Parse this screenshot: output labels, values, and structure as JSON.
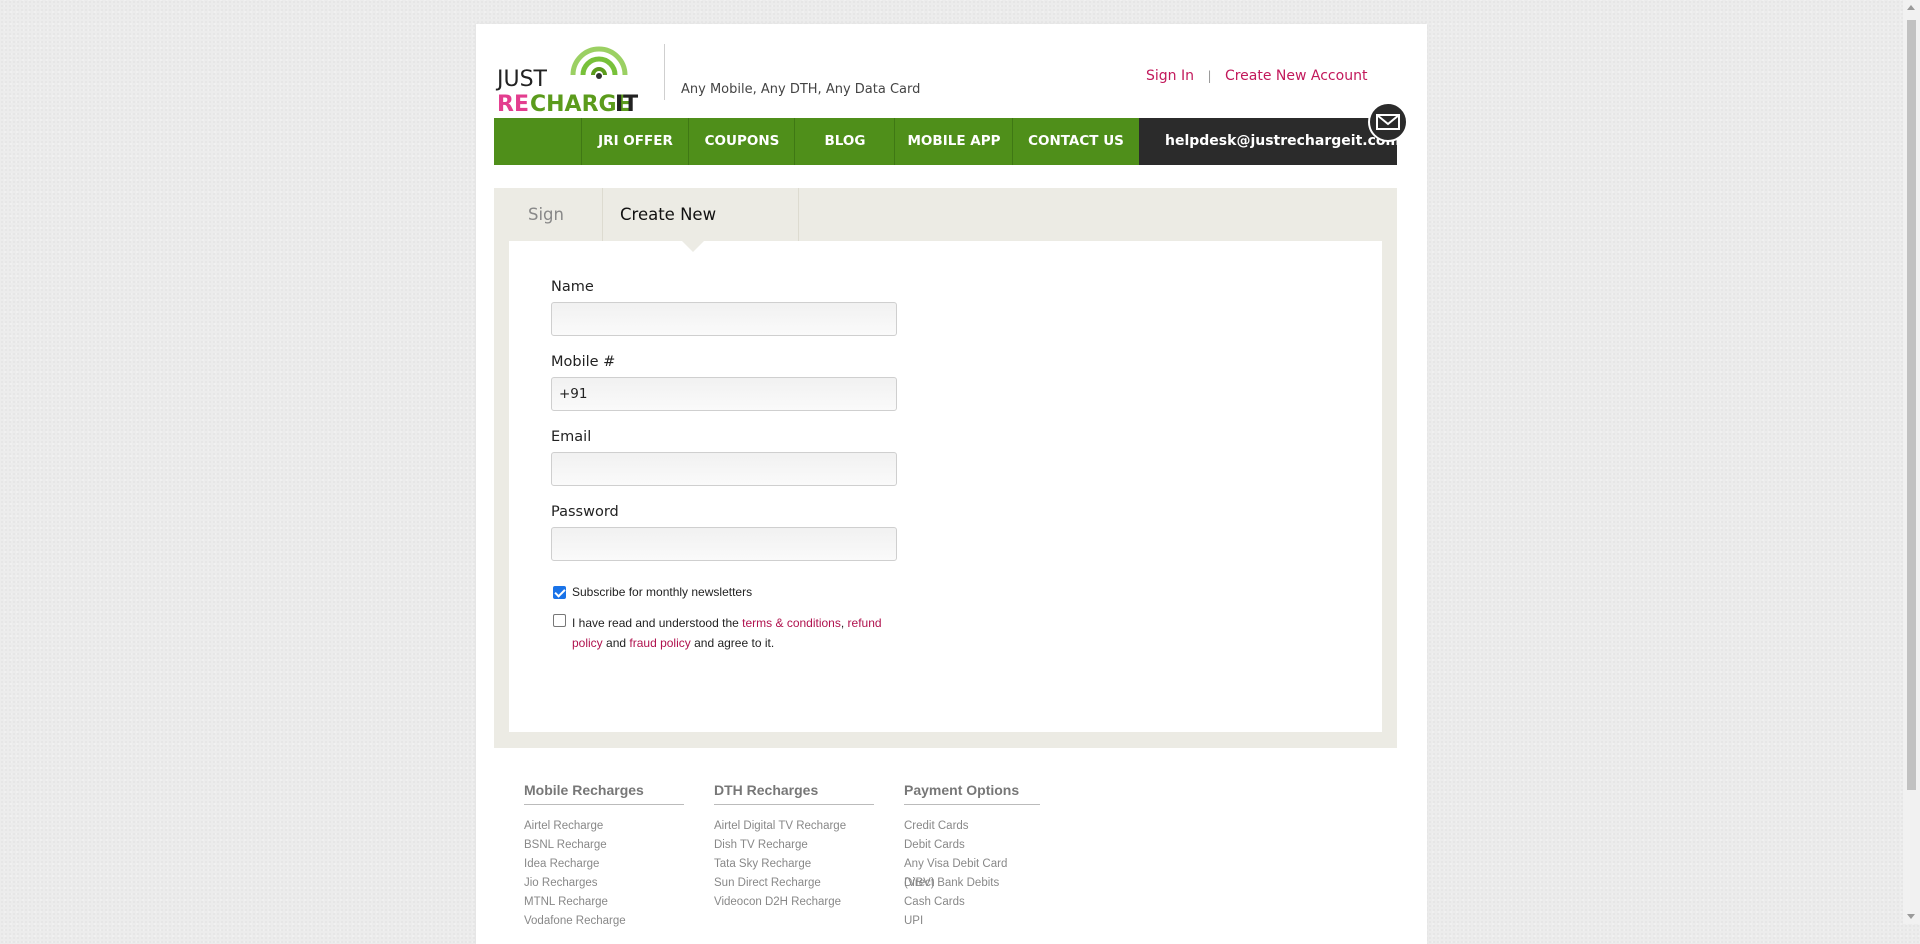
{
  "header": {
    "logo": {
      "just": "JUST",
      "re": "RE",
      "charge": "CHARGE",
      "it": "IT"
    },
    "tagline": "Any Mobile, Any DTH, Any Data Card",
    "signin_link": "Sign In",
    "separator": "|",
    "create_link": "Create New Account"
  },
  "nav": {
    "items": [
      {
        "label": "JRI OFFER"
      },
      {
        "label": "COUPONS"
      },
      {
        "label": "BLOG"
      },
      {
        "label": "MOBILE APP"
      },
      {
        "label": "CONTACT US"
      }
    ],
    "helpdesk": "helpdesk@justrechargeit.com",
    "mail_icon": "envelope-icon",
    "color": "#4f8f1a",
    "helpdesk_bg": "#2b2b2b"
  },
  "tabs": {
    "signin": "Sign In",
    "create": "Create New Account"
  },
  "form": {
    "name_label": "Name",
    "name_value": "",
    "mobile_label": "Mobile #",
    "mobile_value": "+91",
    "email_label": "Email",
    "email_value": "",
    "password_label": "Password",
    "password_value": "",
    "subscribe_label": "Subscribe for monthly newsletters",
    "subscribe_checked": true,
    "terms_prefix": "I have read and understood the ",
    "terms_link": "terms & conditions",
    "comma": ", ",
    "refund_line1": "refund",
    "refund_line2": "policy",
    "and_text": " and ",
    "fraud_link": "fraud policy",
    "agree_text": " and agree to it.",
    "terms_checked": false
  },
  "footer": {
    "mobile": {
      "heading": "Mobile Recharges",
      "links": [
        "Airtel Recharge",
        "BSNL Recharge",
        "Idea Recharge",
        "Jio Recharges",
        "MTNL Recharge",
        "Vodafone Recharge"
      ]
    },
    "dth": {
      "heading": "DTH Recharges",
      "links": [
        "Airtel Digital TV Recharge",
        "Dish TV Recharge",
        "Tata Sky Recharge",
        "Sun Direct Recharge",
        "Videocon D2H Recharge"
      ]
    },
    "payment": {
      "heading": "Payment Options",
      "links": [
        "Credit Cards",
        "Debit Cards",
        "Any Visa Debit Card (VBV)",
        "Direct Bank Debits",
        "Cash Cards",
        "UPI"
      ]
    }
  }
}
